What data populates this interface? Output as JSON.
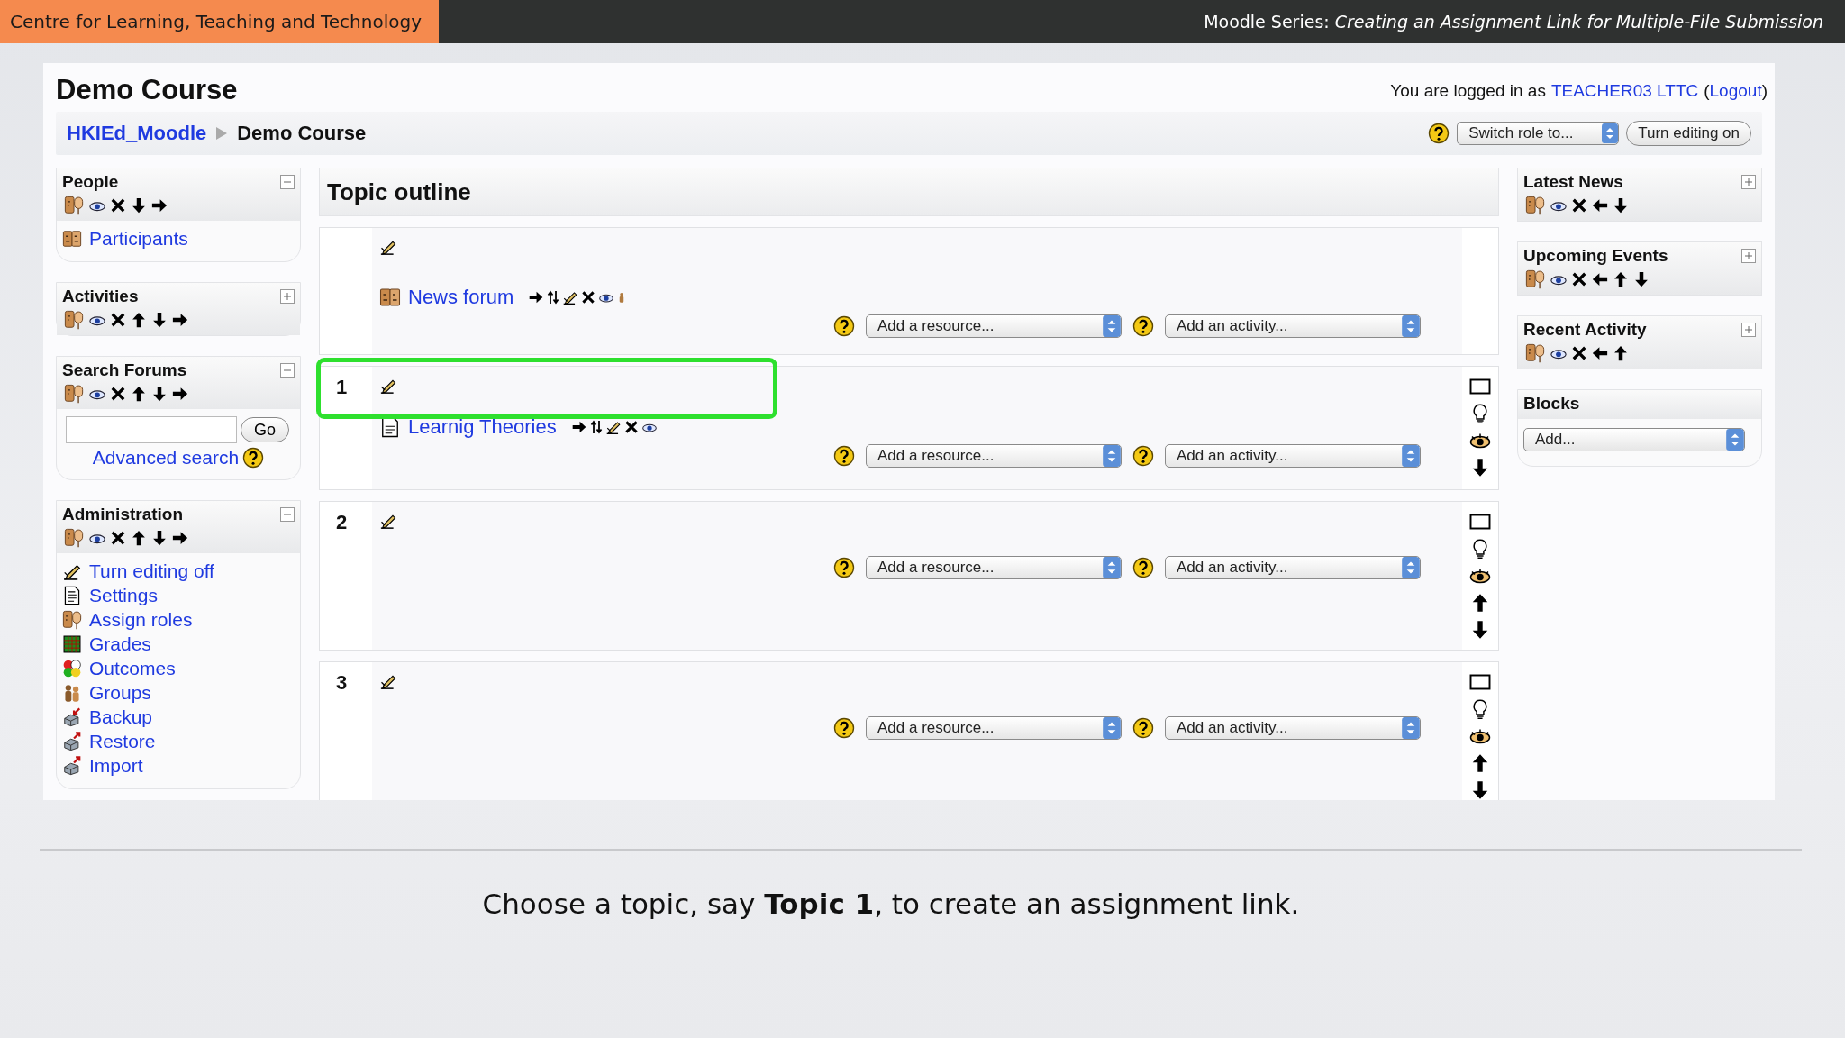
{
  "header": {
    "org": "Centre for Learning, Teaching and Technology",
    "series": "Moodle Series: *Creating an Assignment Link for Multiple-File Submission*"
  },
  "course": {
    "title": "Demo Course",
    "login": {
      "prefix": "You are logged in as",
      "user": "TEACHER03 LTTC",
      "open": "(",
      "logout": "Logout",
      "close": ")"
    },
    "breadcrumb": [
      {
        "label": "HKIEd_Moodle",
        "kind": "link"
      },
      {
        "label": "Demo Course",
        "kind": "current"
      }
    ],
    "switch_role": "Switch role to...",
    "edit_button": "Turn editing on"
  },
  "left_blocks": [
    {
      "title": "People",
      "expanded": true,
      "kind": "participants",
      "movable_up": false,
      "movable_down": true,
      "items": [
        {
          "label": "Participants"
        }
      ]
    },
    {
      "title": "Activities",
      "expanded": false,
      "movable_up": true,
      "movable_down": true
    },
    {
      "title": "Search Forums",
      "expanded": true,
      "kind": "search",
      "movable_up": true,
      "movable_down": true,
      "button": "Go",
      "link": "Advanced search"
    },
    {
      "title": "Administration",
      "expanded": true,
      "kind": "admin",
      "movable_up": true,
      "movable_down": true,
      "items": [
        {
          "label": "Turn editing off"
        },
        {
          "label": "Settings"
        },
        {
          "label": "Assign roles"
        },
        {
          "label": "Grades"
        },
        {
          "label": "Outcomes"
        },
        {
          "label": "Groups"
        },
        {
          "label": "Backup"
        },
        {
          "label": "Restore"
        },
        {
          "label": "Import"
        }
      ]
    }
  ],
  "topic_outline": {
    "title": "Topic outline",
    "sections": [
      {
        "kind": "general",
        "highlighted": false,
        "activities": [
          {
            "label": "News forum",
            "kind": "forum"
          }
        ],
        "add_resource": "Add a resource...",
        "add_activity": "Add an activity..."
      },
      {
        "kind": "topic",
        "number": "1",
        "highlighted": true,
        "movable_up": false,
        "movable_down": true,
        "activities": [
          {
            "label": "Learnig Theories",
            "kind": "resource"
          }
        ],
        "add_resource": "Add a resource...",
        "add_activity": "Add an activity..."
      },
      {
        "kind": "topic",
        "number": "2",
        "highlighted": false,
        "movable_up": true,
        "movable_down": true,
        "add_resource": "Add a resource...",
        "add_activity": "Add an activity..."
      },
      {
        "kind": "topic",
        "number": "3",
        "highlighted": false,
        "movable_up": true,
        "movable_down": true,
        "add_resource": "Add a resource...",
        "add_activity": "Add an activity..."
      }
    ]
  },
  "right_blocks": [
    {
      "title": "Latest News",
      "expanded": false,
      "movable_up": false,
      "movable_down": true
    },
    {
      "title": "Upcoming Events",
      "expanded": false,
      "movable_up": true,
      "movable_down": true
    },
    {
      "title": "Recent Activity",
      "expanded": false,
      "movable_up": true,
      "movable_down": false
    },
    {
      "title": "Blocks",
      "kind": "select",
      "select": "Add..."
    }
  ],
  "caption": "Choose a topic, say **Topic 1**, to create an assignment link."
}
